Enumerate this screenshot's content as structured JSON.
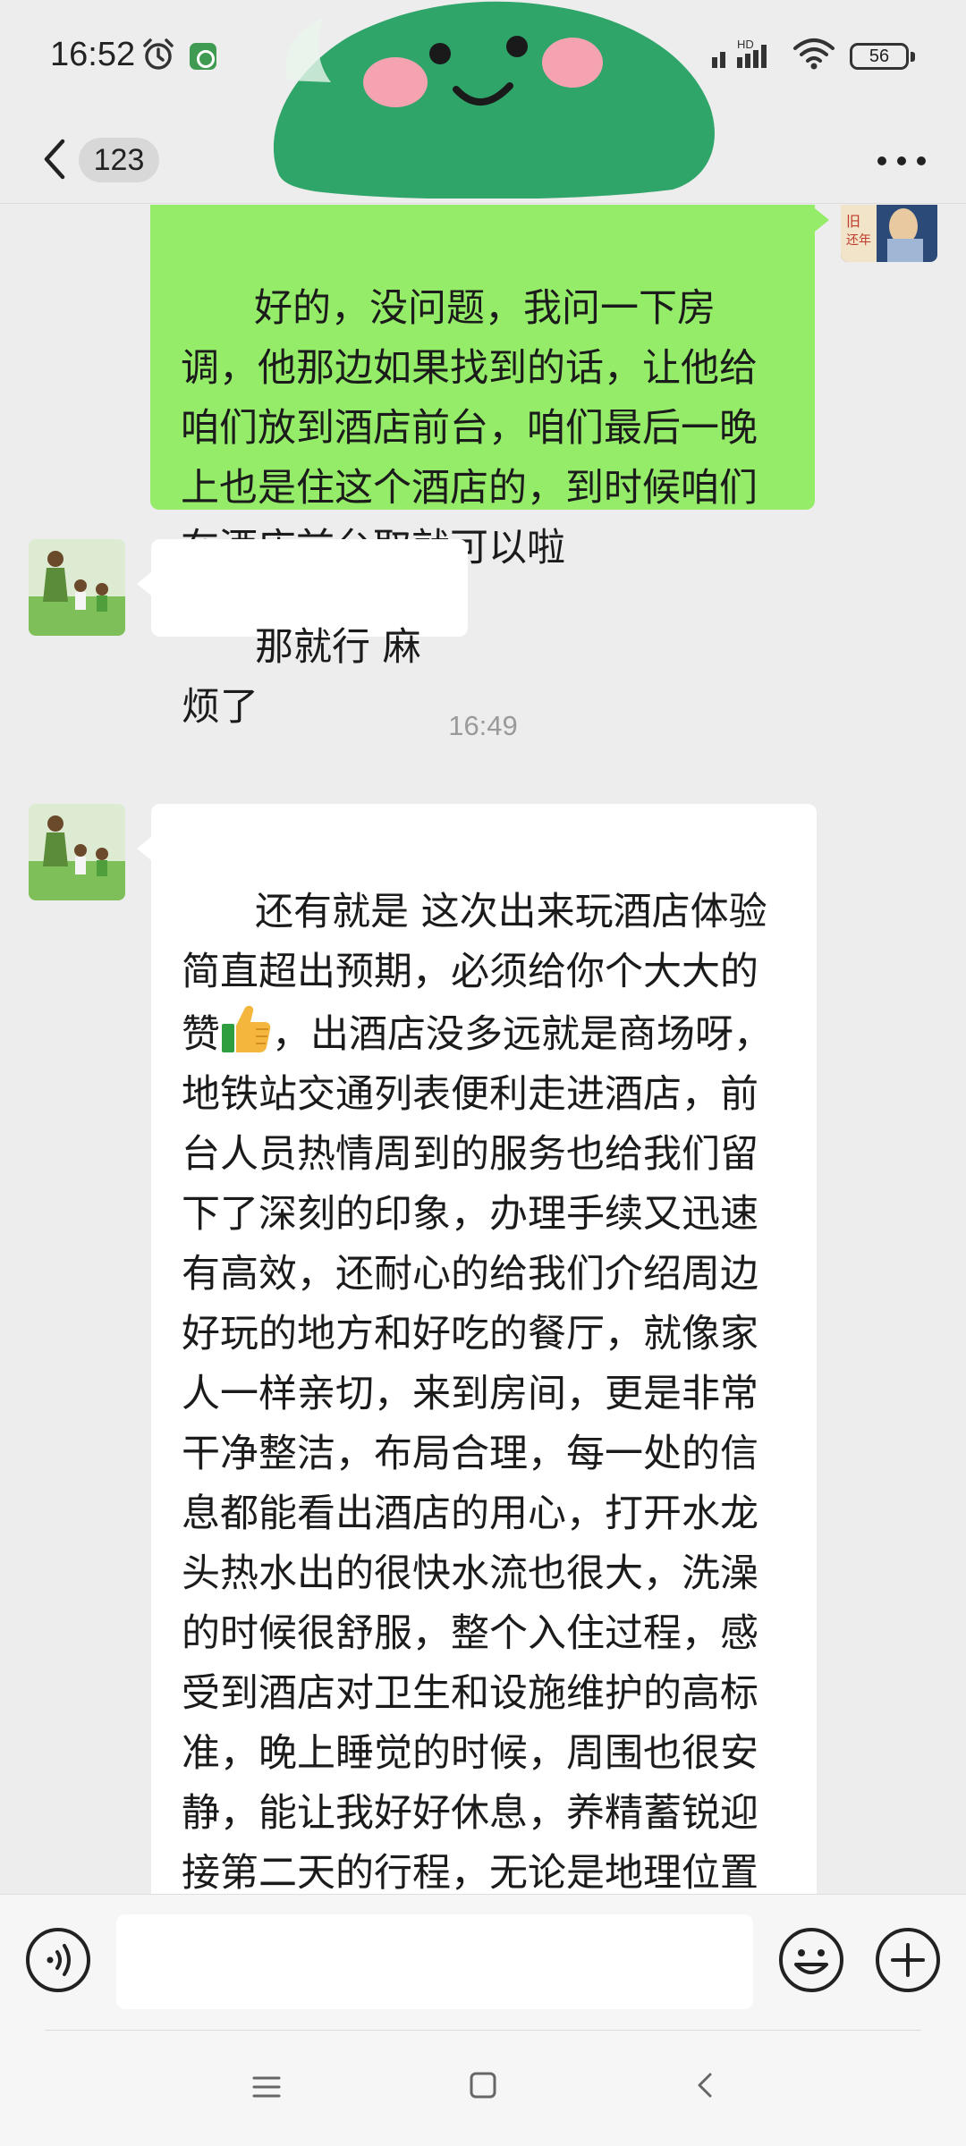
{
  "status_bar": {
    "time": "16:52",
    "network": "HD",
    "battery": "56"
  },
  "header": {
    "unread_count": "123"
  },
  "messages": [
    {
      "direction": "outgoing",
      "text": "好的，没问题，我问一下房调，他那边如果找到的话，让他给咱们放到酒店前台，咱们最后一晚上也是住这个酒店的，到时候咱们在酒店前台取就可以啦"
    },
    {
      "direction": "incoming",
      "text": "那就行 麻烦了"
    },
    {
      "type": "timestamp",
      "text": "16:49"
    },
    {
      "direction": "incoming",
      "text_before_emoji": "还有就是 这次出来玩酒店体验简直超出预期，必须给你个大大的赞",
      "emoji": "thumbs-up",
      "text_after_emoji": "，出酒店没多远就是商场呀，地铁站交通列表便利走进酒店，前台人员热情周到的服务也给我们留下了深刻的印象，办理手续又迅速有高效，还耐心的给我们介绍周边好玩的地方和好吃的餐厅，就像家人一样亲切，来到房间，更是非常干净整洁，布局合理，每一处的信息都能看出酒店的用心，打开水龙头热水出的很快水流也很大，洗澡的时候很舒服，整个入住过程，感受到酒店对卫生和设施维护的高标准，晚上睡觉的时候，周围也很安静，能让我好好休息，养精蓄锐迎接第二天的行程，无论是地理位置服务还是房间设施，周边的配套都"
    }
  ],
  "input": {
    "value": ""
  },
  "colors": {
    "outgoing_bubble": "#95ec69",
    "incoming_bubble": "#ffffff",
    "background": "#ededed",
    "sticker_green": "#2fa56a"
  }
}
